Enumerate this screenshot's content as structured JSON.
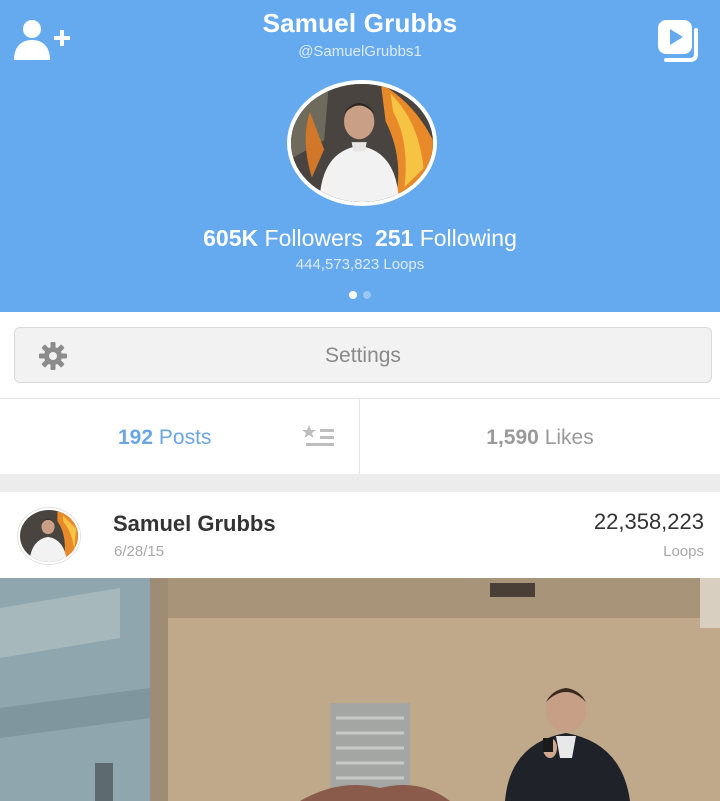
{
  "profile": {
    "name": "Samuel Grubbs",
    "handle": "@SamuelGrubbs1",
    "followers_count": "605K",
    "followers_label": "Followers",
    "following_count": "251",
    "following_label": "Following",
    "loops_total": "444,573,823 Loops",
    "page_indicator": {
      "pages": 2,
      "current": 1
    }
  },
  "icons": {
    "left": "add-user-icon",
    "right": "vine-camera-icon",
    "settings": "gear-icon",
    "sort": "sort-list-icon"
  },
  "settings": {
    "label": "Settings"
  },
  "tabs": {
    "posts_count": "192",
    "posts_label": "Posts",
    "likes_count": "1,590",
    "likes_label": "Likes"
  },
  "post": {
    "author": "Samuel Grubbs",
    "date": "6/28/15",
    "loops_count": "22,358,223",
    "loops_label": "Loops"
  },
  "colors": {
    "header_bg": "#65a9ef",
    "active_tab": "#6ba6e3",
    "inactive_tab": "#9a9a9a"
  }
}
